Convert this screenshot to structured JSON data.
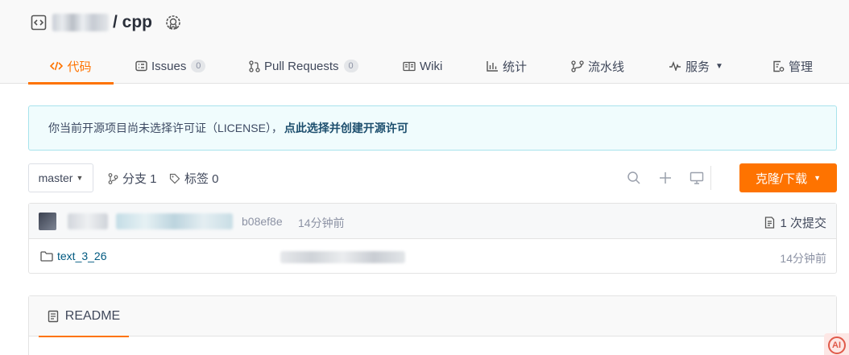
{
  "repo": {
    "name": "/ cpp",
    "icons": {
      "repo": "code-box-icon",
      "badge": "award-badge-icon"
    }
  },
  "tabs": [
    {
      "label": "代码",
      "icon": "code-icon",
      "active": true
    },
    {
      "label": "Issues",
      "icon": "issues-icon",
      "count": "0"
    },
    {
      "label": "Pull Requests",
      "icon": "pull-request-icon",
      "count": "0"
    },
    {
      "label": "Wiki",
      "icon": "wiki-icon"
    },
    {
      "label": "统计",
      "icon": "bar-chart-icon"
    },
    {
      "label": "流水线",
      "icon": "pipeline-icon"
    },
    {
      "label": "服务",
      "icon": "pulse-icon",
      "has_dropdown": true
    },
    {
      "label": "管理",
      "icon": "settings-doc-icon"
    }
  ],
  "notice": {
    "text": "你当前开源项目尚未选择许可证（LICENSE），",
    "link": "点此选择并创建开源许可"
  },
  "toolbar": {
    "branch": "master",
    "branches_label": "分支 1",
    "tags_label": "标签 0",
    "clone_label": "克隆/下载"
  },
  "commit": {
    "hash": "b08ef8e",
    "time": "14分钟前",
    "count_label": "1 次提交"
  },
  "files": [
    {
      "name": "text_3_26",
      "type": "folder",
      "time": "14分钟前"
    }
  ],
  "readme": {
    "title": "README"
  },
  "colors": {
    "accent": "#fe7300",
    "link": "#005980",
    "notice_bg": "#f0fcfd",
    "notice_border": "#a8e3ec"
  },
  "corner_badge": {
    "text": "AI"
  }
}
